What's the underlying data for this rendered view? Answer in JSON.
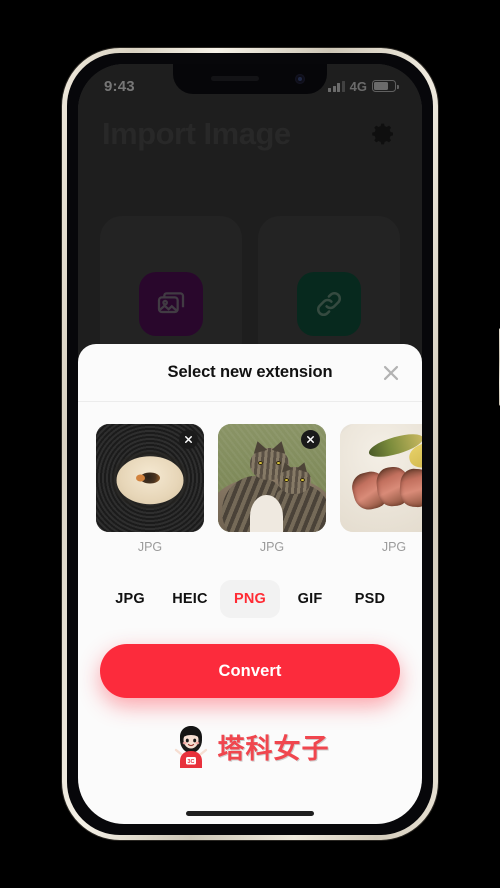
{
  "status_bar": {
    "time": "9:43",
    "network": "4G",
    "signal_icon": "signal-bars-icon",
    "battery_icon": "battery-icon",
    "battery_percent": 70
  },
  "app": {
    "title": "Import Image",
    "settings_icon": "gear-icon",
    "cards": [
      {
        "name": "photo-library-card",
        "icon": "photos-icon",
        "tile_color": "#3b0b40"
      },
      {
        "name": "link-import-card",
        "icon": "link-icon",
        "tile_color": "#0b3b2b"
      }
    ]
  },
  "modal": {
    "title": "Select new extension",
    "close_icon": "close-icon",
    "thumbnails": [
      {
        "name": "thumbnail-soup",
        "format": "JPG",
        "delete_icon": "close-circle-icon",
        "art": "art-soup"
      },
      {
        "name": "thumbnail-cats",
        "format": "JPG",
        "delete_icon": "close-circle-icon",
        "art": "art-cats"
      },
      {
        "name": "thumbnail-steak",
        "format": "JPG",
        "delete_icon": "close-circle-icon",
        "art": "art-steak"
      }
    ],
    "extensions": [
      {
        "label": "JPG",
        "selected": false
      },
      {
        "label": "HEIC",
        "selected": false
      },
      {
        "label": "PNG",
        "selected": true
      },
      {
        "label": "GIF",
        "selected": false
      },
      {
        "label": "PSD",
        "selected": false
      }
    ],
    "convert_label": "Convert"
  },
  "watermark": {
    "text": "塔科女子",
    "avatar_icon": "girl-avatar-icon",
    "shirt_text": "3C"
  },
  "colors": {
    "accent_red": "#fc2b3c",
    "selected_text": "#ff2b34",
    "pill_background": "#f2f2f2",
    "sheet_background": "#fbfbfb",
    "app_background": "#2b2b2b"
  }
}
